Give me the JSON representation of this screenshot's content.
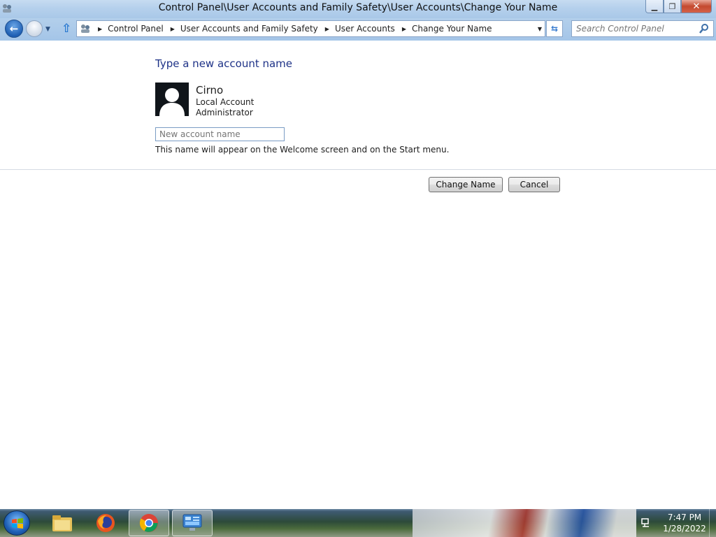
{
  "window": {
    "title": "Control Panel\\User Accounts and Family Safety\\User Accounts\\Change Your Name",
    "minimize_glyph": "▁",
    "maximize_glyph": "❐",
    "close_glyph": "✕"
  },
  "navbar": {
    "breadcrumbs": [
      "Control Panel",
      "User Accounts and Family Safety",
      "User Accounts",
      "Change Your Name"
    ],
    "search_placeholder": "Search Control Panel"
  },
  "content": {
    "heading": "Type a new account name",
    "user": {
      "name": "Cirno",
      "type": "Local Account",
      "role": "Administrator"
    },
    "new_name_placeholder": "New account name",
    "hint": "This name will appear on the Welcome screen and on the Start menu.",
    "change_button": "Change Name",
    "cancel_button": "Cancel"
  },
  "taskbar": {
    "apps": [
      "file-explorer-icon",
      "firefox-icon",
      "chrome-icon",
      "control-panel-icon"
    ],
    "time": "7:47 PM",
    "date": "1/28/2022"
  },
  "colors": {
    "heading": "#1e3287",
    "titlebar": "#b5d0ec"
  }
}
